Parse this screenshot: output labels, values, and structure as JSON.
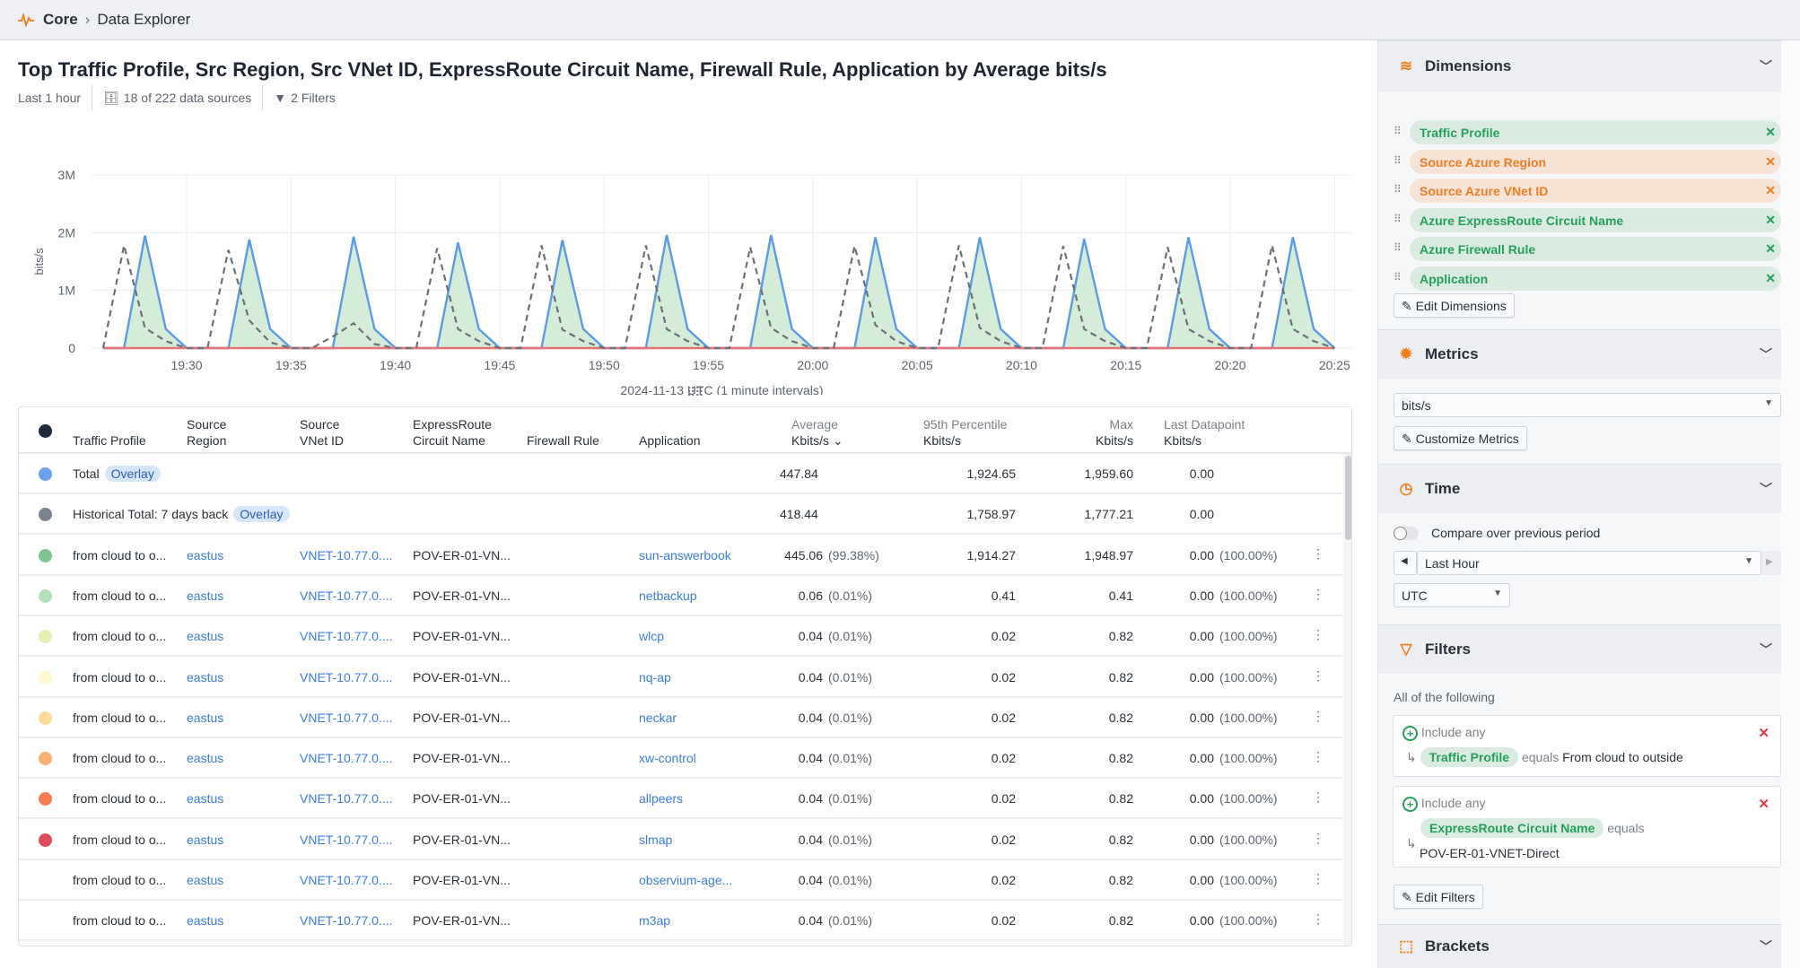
{
  "breadcrumb": {
    "icon": "pulse-icon",
    "root": "Core",
    "current": "Data Explorer"
  },
  "header": {
    "title": "Top Traffic Profile, Src Region, Src VNet ID, ExpressRoute Circuit Name, Firewall Rule, Application by Average bits/s",
    "time_range": "Last 1 hour",
    "data_sources": "18 of 222 data sources",
    "filters": "2 Filters"
  },
  "chart_data": {
    "type": "area",
    "ylabel": "bits/s",
    "xlabel": "2024-11-13 UTC (1 minute intervals)",
    "ylim": [
      0,
      3000000
    ],
    "y_ticks": [
      "0",
      "1M",
      "2M",
      "3M"
    ],
    "x_ticks": [
      "19:30",
      "19:35",
      "19:40",
      "19:45",
      "19:50",
      "19:55",
      "20:00",
      "20:05",
      "20:10",
      "20:15",
      "20:20",
      "20:25"
    ],
    "grid": true,
    "x": [
      "19:26",
      "19:27",
      "19:28",
      "19:29",
      "19:30",
      "19:31",
      "19:32",
      "19:33",
      "19:34",
      "19:35",
      "19:36",
      "19:37",
      "19:38",
      "19:39",
      "19:40",
      "19:41",
      "19:42",
      "19:43",
      "19:44",
      "19:45",
      "19:46",
      "19:47",
      "19:48",
      "19:49",
      "19:50",
      "19:51",
      "19:52",
      "19:53",
      "19:54",
      "19:55",
      "19:56",
      "19:57",
      "19:58",
      "19:59",
      "20:00",
      "20:01",
      "20:02",
      "20:03",
      "20:04",
      "20:05",
      "20:06",
      "20:07",
      "20:08",
      "20:09",
      "20:10",
      "20:11",
      "20:12",
      "20:13",
      "20:14",
      "20:15",
      "20:16",
      "20:17",
      "20:18",
      "20:19",
      "20:20",
      "20:21",
      "20:22",
      "20:23",
      "20:24",
      "20:25"
    ],
    "series": [
      {
        "style": "solid",
        "color": "#5b9be6",
        "fill": "#d5ecd9",
        "values": [
          0,
          0,
          1950000,
          330000,
          0,
          0,
          0,
          1880000,
          330000,
          0,
          0,
          0,
          1930000,
          330000,
          0,
          0,
          0,
          1830000,
          330000,
          0,
          0,
          0,
          1870000,
          330000,
          0,
          0,
          0,
          1960000,
          330000,
          0,
          0,
          0,
          1960000,
          330000,
          0,
          0,
          0,
          1920000,
          330000,
          0,
          0,
          0,
          1920000,
          330000,
          0,
          0,
          0,
          1890000,
          330000,
          0,
          0,
          0,
          1920000,
          330000,
          0,
          0,
          0,
          1920000,
          330000,
          0
        ]
      },
      {
        "style": "dashed",
        "color": "#6b7079",
        "values": [
          0,
          1780000,
          350000,
          120000,
          0,
          0,
          1700000,
          480000,
          100000,
          0,
          0,
          200000,
          430000,
          70000,
          0,
          0,
          1730000,
          330000,
          120000,
          0,
          0,
          1780000,
          320000,
          120000,
          0,
          0,
          1780000,
          330000,
          120000,
          0,
          0,
          1750000,
          350000,
          120000,
          0,
          0,
          1770000,
          400000,
          120000,
          0,
          0,
          1780000,
          350000,
          120000,
          0,
          0,
          1770000,
          330000,
          120000,
          0,
          0,
          1750000,
          330000,
          120000,
          0,
          0,
          1780000,
          330000,
          120000,
          0
        ]
      },
      {
        "style": "solid",
        "color": "#e57373",
        "values": [
          0,
          0,
          0,
          0,
          0,
          0,
          0,
          0,
          0,
          0,
          0,
          0,
          0,
          0,
          0,
          0,
          0,
          0,
          0,
          0,
          0,
          0,
          0,
          0,
          0,
          0,
          0,
          0,
          0,
          0,
          0,
          0,
          0,
          0,
          0,
          0,
          0,
          0,
          0,
          0,
          0,
          0,
          0,
          0,
          0,
          0,
          0,
          0,
          0,
          0,
          0,
          0,
          0,
          0,
          0,
          0,
          0,
          0,
          0,
          0
        ]
      }
    ]
  },
  "table": {
    "headers": {
      "traffic_profile": "Traffic Profile",
      "src_region_1": "Source",
      "src_region_2": "Region",
      "vnet_1": "Source",
      "vnet_2": "VNet ID",
      "er_1": "ExpressRoute",
      "er_2": "Circuit Name",
      "firewall": "Firewall Rule",
      "application": "Application",
      "avg_1": "Average",
      "avg_2": "Kbits/s",
      "p95_1": "95th Percentile",
      "p95_2": "Kbits/s",
      "max_1": "Max",
      "max_2": "Kbits/s",
      "last_1": "Last Datapoint",
      "last_2": "Kbits/s"
    },
    "overlays": [
      {
        "color": "#6aa3ea",
        "label": "Total",
        "badge": "Overlay",
        "avg": "447.84",
        "p95": "1,924.65",
        "max": "1,959.60",
        "last": "0.00"
      },
      {
        "color": "#7d838c",
        "label": "Historical Total: 7 days back",
        "badge": "Overlay",
        "avg": "418.44",
        "p95": "1,758.97",
        "max": "1,777.21",
        "last": "0.00"
      }
    ],
    "rows": [
      {
        "color": "#7fc591",
        "profile": "from cloud to o...",
        "region": "eastus",
        "vnet": "VNET-10.77.0....",
        "circuit": "POV-ER-01-VN...",
        "firewall": "",
        "app": "sun-answerbook",
        "avg": "445.06",
        "avg_pct": "(99.38%)",
        "p95": "1,914.27",
        "max": "1,948.97",
        "last": "0.00",
        "last_pct": "(100.00%)"
      },
      {
        "color": "#b2e0b8",
        "profile": "from cloud to o...",
        "region": "eastus",
        "vnet": "VNET-10.77.0....",
        "circuit": "POV-ER-01-VN...",
        "firewall": "",
        "app": "netbackup",
        "avg": "0.06",
        "avg_pct": "(0.01%)",
        "p95": "0.41",
        "max": "0.41",
        "last": "0.00",
        "last_pct": "(100.00%)"
      },
      {
        "color": "#e4efb0",
        "profile": "from cloud to o...",
        "region": "eastus",
        "vnet": "VNET-10.77.0....",
        "circuit": "POV-ER-01-VN...",
        "firewall": "",
        "app": "wlcp",
        "avg": "0.04",
        "avg_pct": "(0.01%)",
        "p95": "0.02",
        "max": "0.82",
        "last": "0.00",
        "last_pct": "(100.00%)"
      },
      {
        "color": "#fdf8cf",
        "profile": "from cloud to o...",
        "region": "eastus",
        "vnet": "VNET-10.77.0....",
        "circuit": "POV-ER-01-VN...",
        "firewall": "",
        "app": "nq-ap",
        "avg": "0.04",
        "avg_pct": "(0.01%)",
        "p95": "0.02",
        "max": "0.82",
        "last": "0.00",
        "last_pct": "(100.00%)"
      },
      {
        "color": "#fddc97",
        "profile": "from cloud to o...",
        "region": "eastus",
        "vnet": "VNET-10.77.0....",
        "circuit": "POV-ER-01-VN...",
        "firewall": "",
        "app": "neckar",
        "avg": "0.04",
        "avg_pct": "(0.01%)",
        "p95": "0.02",
        "max": "0.82",
        "last": "0.00",
        "last_pct": "(100.00%)"
      },
      {
        "color": "#fbb070",
        "profile": "from cloud to o...",
        "region": "eastus",
        "vnet": "VNET-10.77.0....",
        "circuit": "POV-ER-01-VN...",
        "firewall": "",
        "app": "xw-control",
        "avg": "0.04",
        "avg_pct": "(0.01%)",
        "p95": "0.02",
        "max": "0.82",
        "last": "0.00",
        "last_pct": "(100.00%)"
      },
      {
        "color": "#f77b50",
        "profile": "from cloud to o...",
        "region": "eastus",
        "vnet": "VNET-10.77.0....",
        "circuit": "POV-ER-01-VN...",
        "firewall": "",
        "app": "allpeers",
        "avg": "0.04",
        "avg_pct": "(0.01%)",
        "p95": "0.02",
        "max": "0.82",
        "last": "0.00",
        "last_pct": "(100.00%)"
      },
      {
        "color": "#de4c5c",
        "profile": "from cloud to o...",
        "region": "eastus",
        "vnet": "VNET-10.77.0....",
        "circuit": "POV-ER-01-VN...",
        "firewall": "",
        "app": "slmap",
        "avg": "0.04",
        "avg_pct": "(0.01%)",
        "p95": "0.02",
        "max": "0.82",
        "last": "0.00",
        "last_pct": "(100.00%)"
      },
      {
        "color": "",
        "profile": "from cloud to o...",
        "region": "eastus",
        "vnet": "VNET-10.77.0....",
        "circuit": "POV-ER-01-VN...",
        "firewall": "",
        "app": "observium-age...",
        "avg": "0.04",
        "avg_pct": "(0.01%)",
        "p95": "0.02",
        "max": "0.82",
        "last": "0.00",
        "last_pct": "(100.00%)"
      },
      {
        "color": "",
        "profile": "from cloud to o...",
        "region": "eastus",
        "vnet": "VNET-10.77.0....",
        "circuit": "POV-ER-01-VN...",
        "firewall": "",
        "app": "m3ap",
        "avg": "0.04",
        "avg_pct": "(0.01%)",
        "p95": "0.02",
        "max": "0.82",
        "last": "0.00",
        "last_pct": "(100.00%)"
      }
    ]
  },
  "sidebar": {
    "dimensions": {
      "title": "Dimensions",
      "items": [
        {
          "label": "Traffic Profile",
          "tone": "g"
        },
        {
          "label": "Source Azure Region",
          "tone": "o"
        },
        {
          "label": "Source Azure VNet ID",
          "tone": "o"
        },
        {
          "label": "Azure ExpressRoute Circuit Name",
          "tone": "g"
        },
        {
          "label": "Azure Firewall Rule",
          "tone": "g"
        },
        {
          "label": "Application",
          "tone": "g"
        }
      ],
      "edit_label": "Edit Dimensions"
    },
    "metrics": {
      "title": "Metrics",
      "selected": "bits/s",
      "customize_label": "Customize Metrics"
    },
    "time": {
      "title": "Time",
      "compare_label": "Compare over previous period",
      "compare_on": false,
      "range": "Last Hour",
      "timezone": "UTC"
    },
    "filters": {
      "title": "Filters",
      "mode": "All of the following",
      "groups": [
        {
          "label": "Include any",
          "field": "Traffic Profile",
          "op": "equals",
          "value": "From cloud to outside"
        },
        {
          "label": "Include any",
          "field": "ExpressRoute Circuit Name",
          "op": "equals",
          "value": "POV-ER-01-VNET-Direct"
        }
      ],
      "edit_label": "Edit Filters"
    },
    "brackets": {
      "title": "Brackets"
    }
  }
}
